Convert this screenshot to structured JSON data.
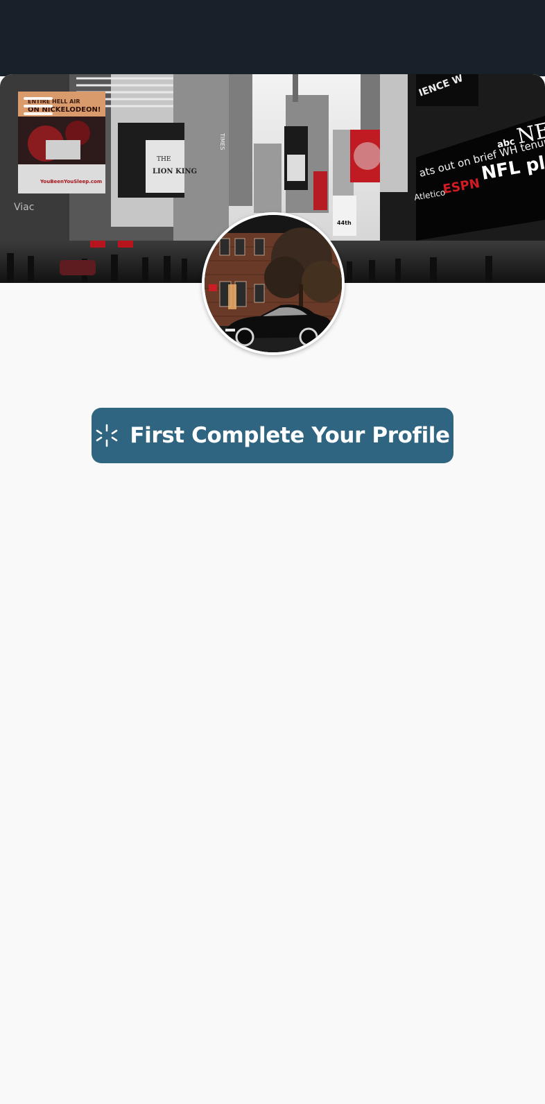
{
  "header": {
    "menu_icon": "menu-icon"
  },
  "cover": {
    "signs": {
      "nickelodeon_top": "ENTIRE HELL AIR",
      "nickelodeon": "ON NICKELODEON!",
      "nick_url": "YouBeenYouSleep.com",
      "lion_king_the": "THE",
      "lion_king": "LION KING",
      "viacom_left": "Viac",
      "times": "TIMES",
      "ticker": "ats out on brief WH tenure",
      "abc": "abc",
      "news": "NEW",
      "nfl": "NFL play",
      "espn": "ESPN",
      "atletico": "Atletico",
      "street": "44th",
      "science": "IENCE W"
    }
  },
  "avatar": {
    "alt": "profile photo of brick building with vintage car"
  },
  "cta": {
    "label": "First Complete Your Profile",
    "icon": "spinner-icon",
    "color": "#2f6580"
  }
}
